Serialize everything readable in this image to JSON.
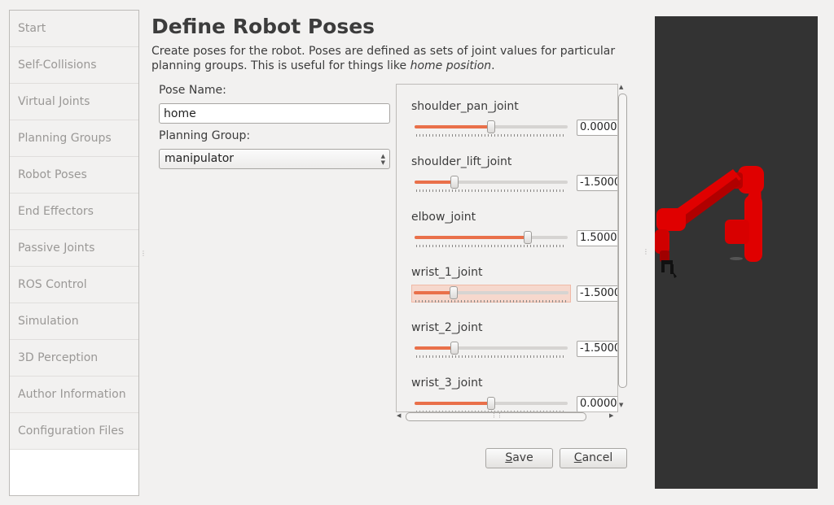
{
  "sidebar": {
    "items": [
      {
        "label": "Start"
      },
      {
        "label": "Self-Collisions"
      },
      {
        "label": "Virtual Joints"
      },
      {
        "label": "Planning Groups"
      },
      {
        "label": "Robot Poses"
      },
      {
        "label": "End Effectors"
      },
      {
        "label": "Passive Joints"
      },
      {
        "label": "ROS Control"
      },
      {
        "label": "Simulation"
      },
      {
        "label": "3D Perception"
      },
      {
        "label": "Author Information"
      },
      {
        "label": "Configuration Files"
      }
    ]
  },
  "header": {
    "title": "Define Robot Poses",
    "description_prefix": "Create poses for the robot. Poses are defined as sets of joint values for particular planning groups. This is useful for things like ",
    "description_emphasis": "home position",
    "description_suffix": "."
  },
  "form": {
    "pose_name_label": "Pose Name:",
    "pose_name_value": "home",
    "planning_group_label": "Planning Group:",
    "planning_group_value": "manipulator"
  },
  "joints": [
    {
      "name": "shoulder_pan_joint",
      "value": "0.0000",
      "fraction": 0.5,
      "focused": false
    },
    {
      "name": "shoulder_lift_joint",
      "value": "-1.5000",
      "fraction": 0.26,
      "focused": false
    },
    {
      "name": "elbow_joint",
      "value": "1.5000",
      "fraction": 0.74,
      "focused": false
    },
    {
      "name": "wrist_1_joint",
      "value": "-1.5000",
      "fraction": 0.26,
      "focused": true
    },
    {
      "name": "wrist_2_joint",
      "value": "-1.5000",
      "fraction": 0.26,
      "focused": false
    },
    {
      "name": "wrist_3_joint",
      "value": "0.0000",
      "fraction": 0.5,
      "focused": false
    }
  ],
  "buttons": {
    "save_mnemonic": "S",
    "save_rest": "ave",
    "cancel_mnemonic": "C",
    "cancel_rest": "ancel"
  },
  "colors": {
    "accent": "#e9704a",
    "robot": "#e00000",
    "viewport_bg": "#333333"
  }
}
